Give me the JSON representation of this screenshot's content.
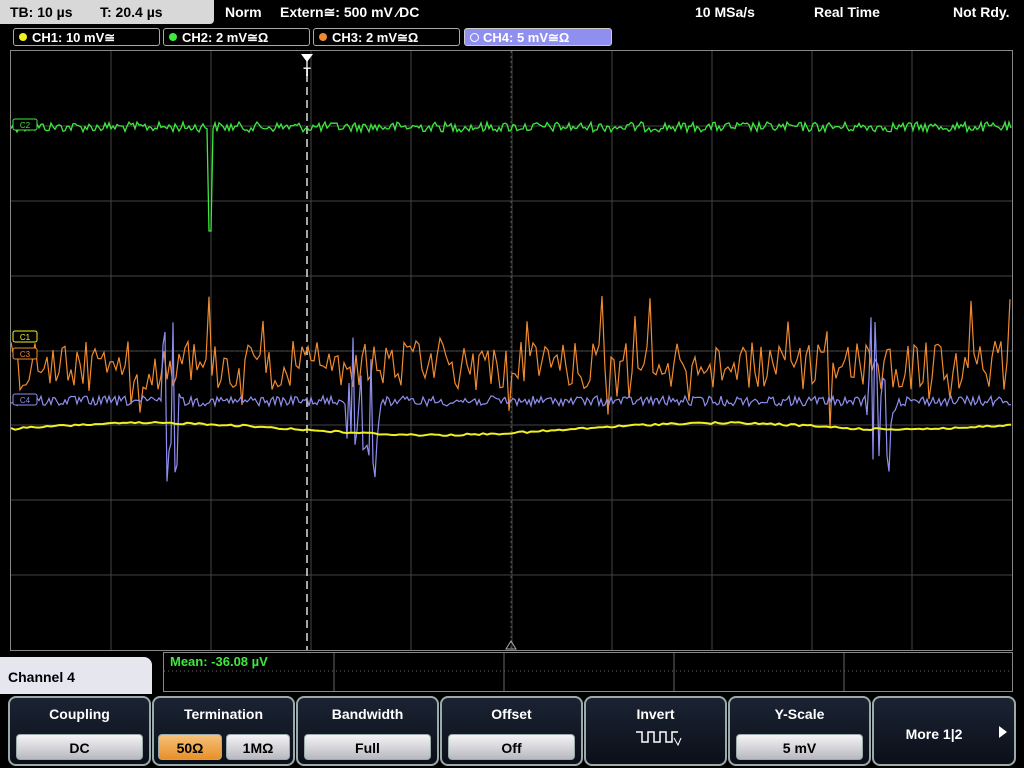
{
  "status": {
    "timebase": "TB: 10 µs",
    "trigger_time": "T: 20.4 µs",
    "mode": "Norm",
    "trigger_source": "Extern≅: 500 mV ⁄DC",
    "sample_rate": "10 MSa/s",
    "acq_mode": "Real Time",
    "state": "Not Rdy."
  },
  "channels": [
    {
      "label": "CH1: 10 mV≅",
      "color": "#f0f020"
    },
    {
      "label": "CH2: 2 mV≅Ω",
      "color": "#3ee83e"
    },
    {
      "label": "CH3: 2 mV≅Ω",
      "color": "#f08a30"
    },
    {
      "label": "CH4: 5 mV≅Ω",
      "color": "#8f8ff0",
      "active": true
    }
  ],
  "markers": {
    "ch1": "C1",
    "ch2": "C2",
    "ch3": "C3",
    "ch4": "C4",
    "trigger": "T"
  },
  "measurement": {
    "label": "Mean: -36.08 µV"
  },
  "menu": {
    "title": "Channel 4"
  },
  "softkeys": {
    "coupling": {
      "label": "Coupling",
      "value": "DC"
    },
    "termination": {
      "label": "Termination",
      "options": [
        "50Ω",
        "1MΩ"
      ],
      "selected": "50Ω"
    },
    "bandwidth": {
      "label": "Bandwidth",
      "value": "Full"
    },
    "offset": {
      "label": "Offset",
      "value": "Off"
    },
    "invert": {
      "label": "Invert",
      "icon": "invert-waveform-icon"
    },
    "yscale": {
      "label": "Y-Scale",
      "value": "5 mV"
    },
    "more": {
      "label": "More 1|2",
      "icon": "arrow-right-icon"
    }
  }
}
